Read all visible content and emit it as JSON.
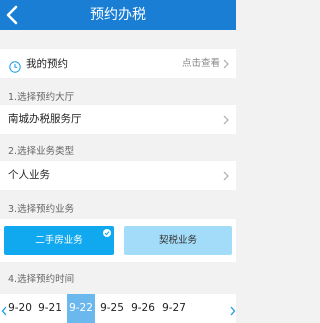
{
  "header": {
    "title": "预约办税"
  },
  "my_appointment": {
    "label": "我的预约",
    "link": "点击查看"
  },
  "hall": {
    "section_label": "1.选择预约大厅",
    "value": "南城办税服务厅"
  },
  "business_type": {
    "section_label": "2.选择业务类型",
    "value": "个人业务"
  },
  "business": {
    "section_label": "3.选择预约业务",
    "options": [
      "二手房业务",
      "契税业务"
    ],
    "selected": "二手房业务"
  },
  "time": {
    "section_label": "4.选择预约时间",
    "dates": [
      "9-20",
      "9-21",
      "9-22",
      "9-25",
      "9-26",
      "9-27"
    ],
    "selected": "9-22"
  },
  "colors": {
    "header": "#1a7fd4",
    "accent": "#10a8ef",
    "accent_light": "#a3dcf8",
    "date_selected": "#6bb8ee"
  }
}
